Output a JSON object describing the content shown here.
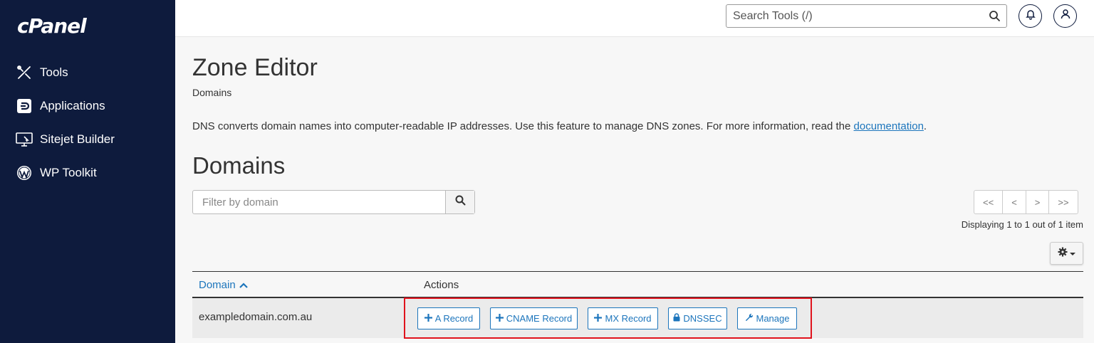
{
  "sidebar": {
    "logo": "cPanel",
    "items": [
      {
        "label": "Tools",
        "icon": "tools-icon"
      },
      {
        "label": "Applications",
        "icon": "applications-icon"
      },
      {
        "label": "Sitejet Builder",
        "icon": "sitejet-icon"
      },
      {
        "label": "WP Toolkit",
        "icon": "wordpress-icon"
      }
    ]
  },
  "header": {
    "search_placeholder": "Search Tools (/)"
  },
  "page": {
    "title": "Zone Editor",
    "breadcrumb": "Domains",
    "description": "DNS converts domain names into computer-readable IP addresses. Use this feature to manage DNS zones. For more information, read the ",
    "doc_link": "documentation",
    "description_end": ".",
    "section_title": "Domains"
  },
  "filter": {
    "placeholder": "Filter by domain"
  },
  "pagination": {
    "first": "<<",
    "prev": "<",
    "next": ">",
    "last": ">>",
    "displaying": "Displaying 1 to 1 out of 1 item"
  },
  "table": {
    "columns": [
      "Domain",
      "Actions"
    ],
    "rows": [
      {
        "domain": "exampledomain.com.au",
        "actions": [
          "A Record",
          "CNAME Record",
          "MX Record",
          "DNSSEC",
          "Manage"
        ]
      }
    ]
  },
  "colors": {
    "sidebar_bg": "#0e1b3d",
    "link_blue": "#1c75bc",
    "highlight_red": "#e0131d"
  }
}
